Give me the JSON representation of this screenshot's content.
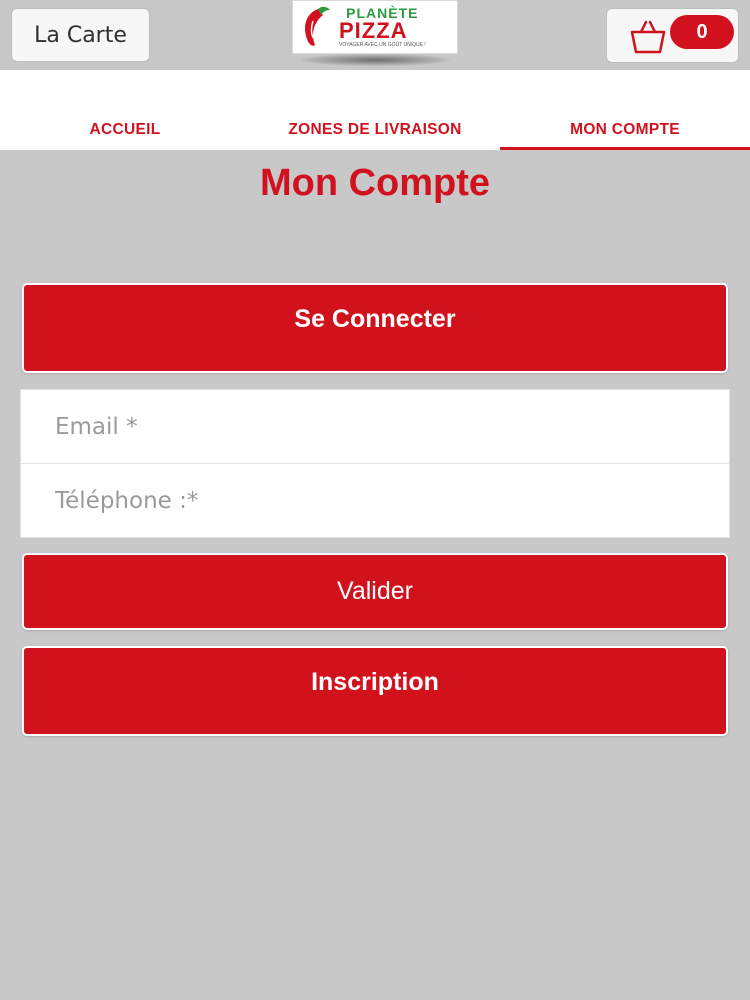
{
  "header": {
    "menu_label": "La Carte",
    "logo": {
      "line1": "PLANÈTE",
      "line2": "PIZZA",
      "tagline": "VOYAGER AVEC UN GOÛT UNIQUE !"
    },
    "cart": {
      "icon": "shopping-bag-icon",
      "count": "0"
    }
  },
  "tabs": [
    {
      "label": "ACCUEIL",
      "active": false
    },
    {
      "label": "ZONES DE LIVRAISON",
      "active": false
    },
    {
      "label": "MON COMPTE",
      "active": true
    }
  ],
  "page": {
    "title": "Mon Compte"
  },
  "login": {
    "connect_label": "Se Connecter",
    "email_placeholder": "Email *",
    "phone_placeholder": "Téléphone :*",
    "validate_label": "Valider",
    "signup_label": "Inscription"
  },
  "colors": {
    "accent_red": "#d1121e",
    "logo_green": "#2b9a3c",
    "background": "#c8c8c8"
  }
}
